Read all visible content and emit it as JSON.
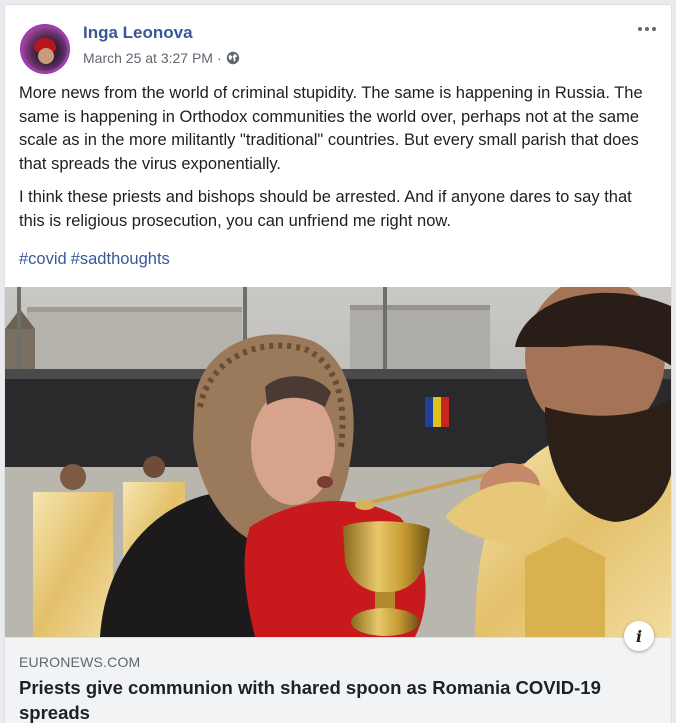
{
  "post": {
    "author": "Inga Leonova",
    "timestamp": "March 25 at 3:27 PM",
    "separator": "·",
    "privacy_icon": "globe-icon",
    "paragraphs": [
      "More news from the world of criminal stupidity. The same is happening in Russia. The same is happening in Orthodox communities the world over, perhaps not at the same scale as in the more militantly \"traditional\" countries. But every small parish that does that spreads the virus exponentially.",
      "I think these priests and bishops should be arrested. And if anyone dares to say that this is religious prosecution, you can unfriend me right now."
    ],
    "hashtags": [
      "#covid",
      "#sadthoughts"
    ]
  },
  "link_preview": {
    "domain": "EURONEWS.COM",
    "headline": "Priests give communion with shared spoon as Romania COVID-19 spreads",
    "info_icon_label": "i"
  },
  "colors": {
    "link_blue": "#385898",
    "text": "#1c1e21",
    "meta_gray": "#616770",
    "footer_bg": "#f2f3f5"
  }
}
